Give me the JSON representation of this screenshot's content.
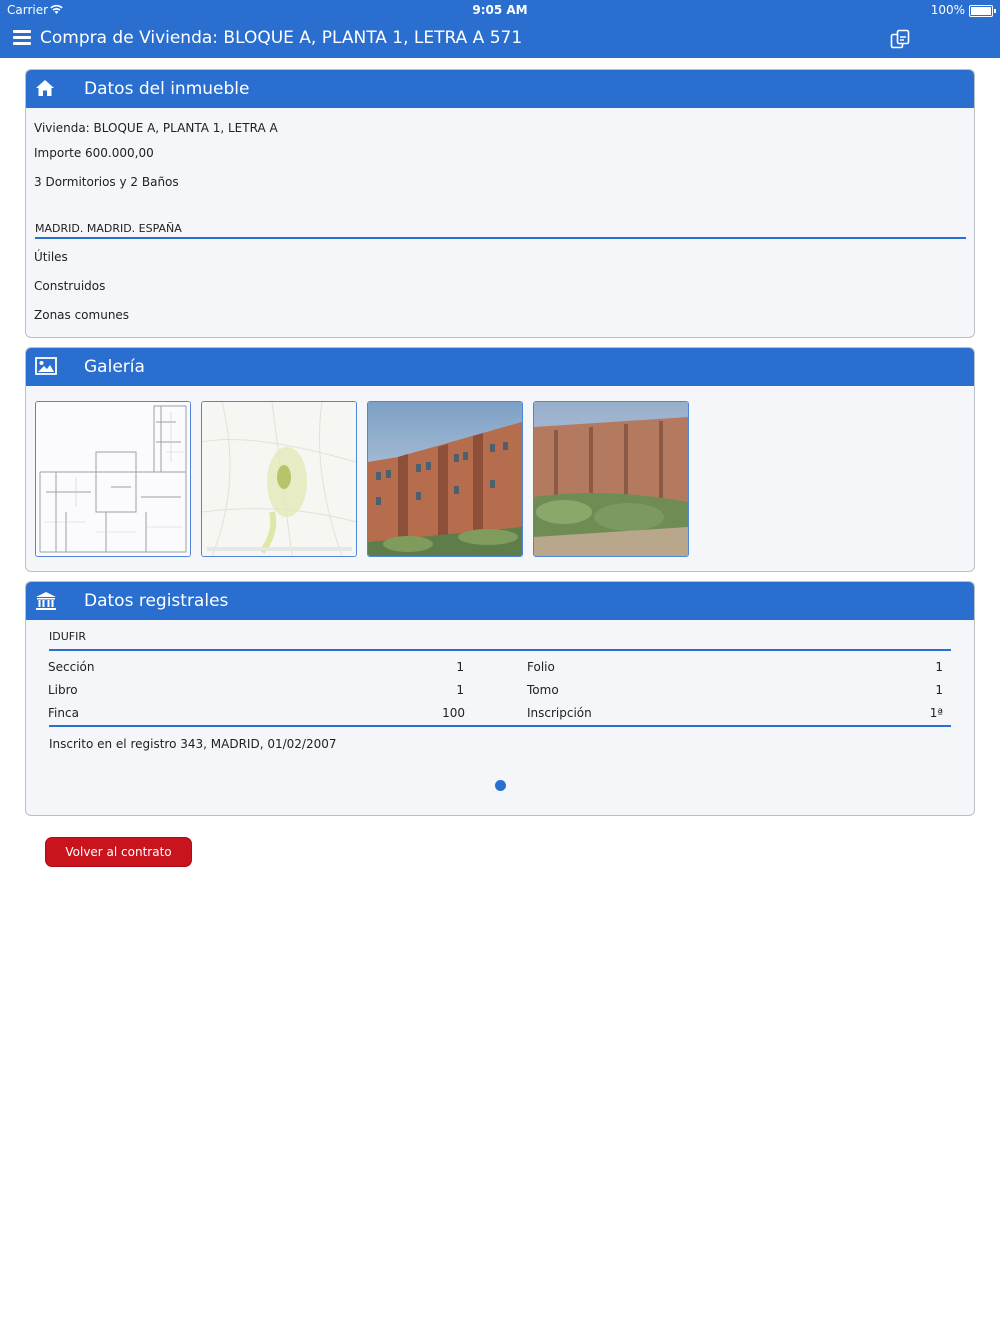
{
  "status_bar": {
    "carrier": "Carrier",
    "time": "9:05 AM",
    "battery": "100%"
  },
  "nav": {
    "title": "Compra de Vivienda: BLOQUE A, PLANTA 1, LETRA A 571",
    "menu_icon": "hamburger-icon",
    "action_icon": "copy-icon"
  },
  "inmueble": {
    "header": "Datos del inmueble",
    "icon": "home-icon",
    "vivienda": "Vivienda: BLOQUE A, PLANTA 1, LETRA A",
    "importe": "Importe 600.000,00",
    "dormitorios": "3 Dormitorios y 2 Baños",
    "ubicacion": "MADRID. MADRID. ESPAÑA",
    "utiles": "Útiles",
    "construidos": "Construidos",
    "zonas_comunes": "Zonas comunes"
  },
  "galeria": {
    "header": "Galería",
    "icon": "image-icon",
    "images": [
      "floor-plan",
      "location-map",
      "building-photo",
      "building-garden-photo"
    ]
  },
  "registro": {
    "header": "Datos registrales",
    "icon": "bank-icon",
    "idufir": "IDUFIR",
    "seccion_label": "Sección",
    "seccion_value": "1",
    "folio_label": "Folio",
    "folio_value": "1",
    "libro_label": "Libro",
    "libro_value": "1",
    "tomo_label": "Tomo",
    "tomo_value": "1",
    "finca_label": "Finca",
    "finca_value": "100",
    "inscripcion_label": "Inscripción",
    "inscripcion_value": "1ª",
    "inscrito": "Inscrito en el registro 343, MADRID, 01/02/2007"
  },
  "actions": {
    "back_label": "Volver al contrato"
  },
  "colors": {
    "primary": "#2a6fcf",
    "button": "#c9141e",
    "card_bg": "#f4f6f9"
  }
}
